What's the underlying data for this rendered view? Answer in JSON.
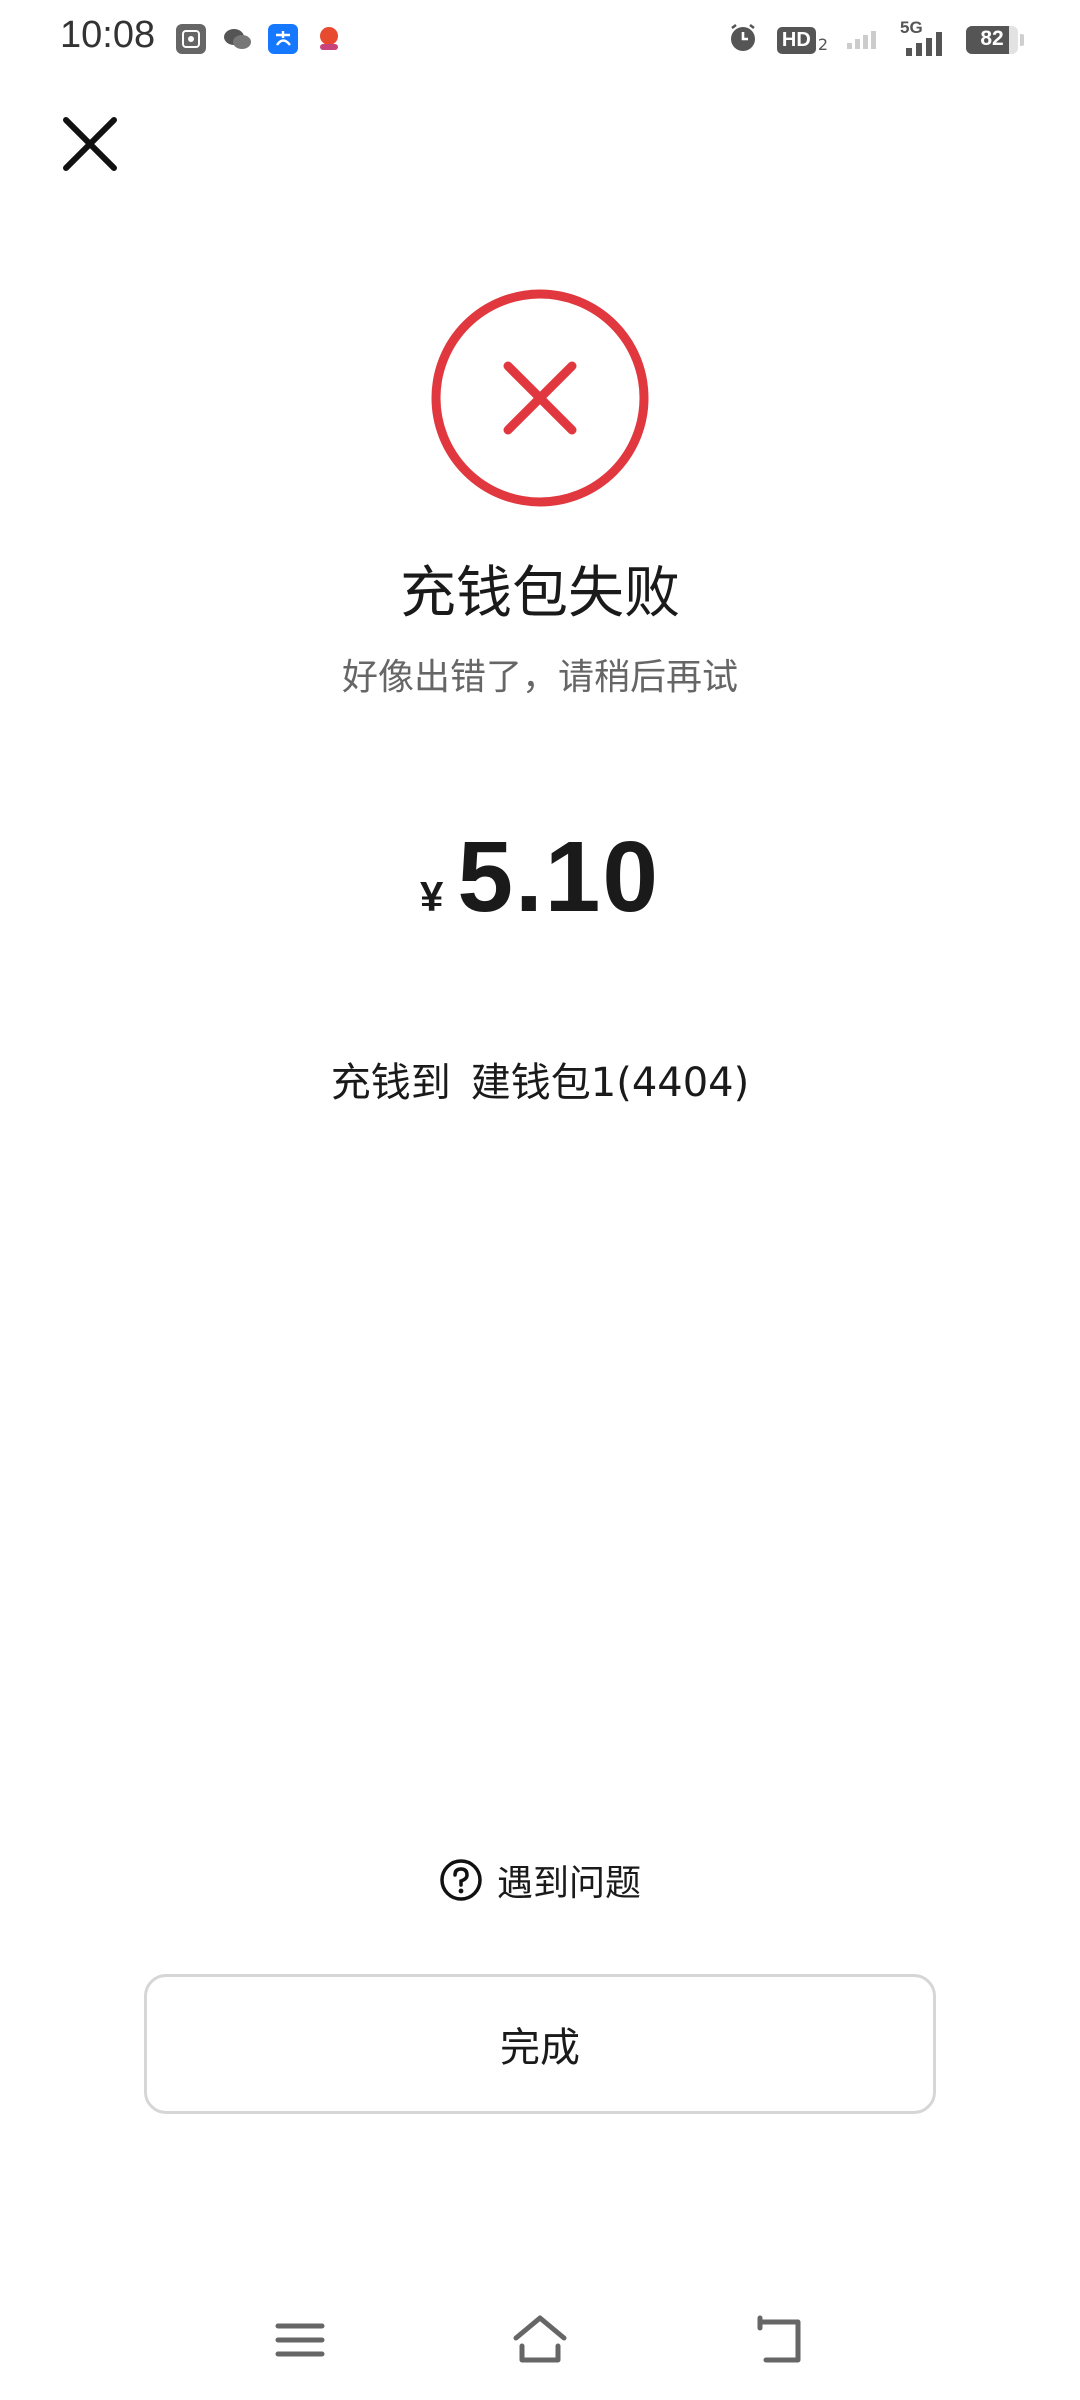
{
  "status_bar": {
    "time": "10:08",
    "app_icons": [
      "gallery-icon",
      "wechat-icon",
      "alipay-icon",
      "promo-app-icon"
    ],
    "hd_label": "HD",
    "hd_sub": "2",
    "network": "5G",
    "battery_level": "82",
    "battery_percent": 82
  },
  "result": {
    "title": "充钱包失败",
    "subtitle": "好像出错了，请稍后再试",
    "currency_symbol": "¥",
    "amount": "5.10",
    "destination_label": "充钱到",
    "destination_wallet": "建钱包1(4404)"
  },
  "help": {
    "label": "遇到问题"
  },
  "actions": {
    "done_label": "完成"
  },
  "colors": {
    "error_red": "#e0383e",
    "text_primary": "#1a1a1a",
    "text_secondary": "#666666",
    "button_border": "#d6d6d6"
  },
  "nav": {
    "buttons": [
      "menu-icon",
      "home-icon",
      "back-icon"
    ]
  }
}
